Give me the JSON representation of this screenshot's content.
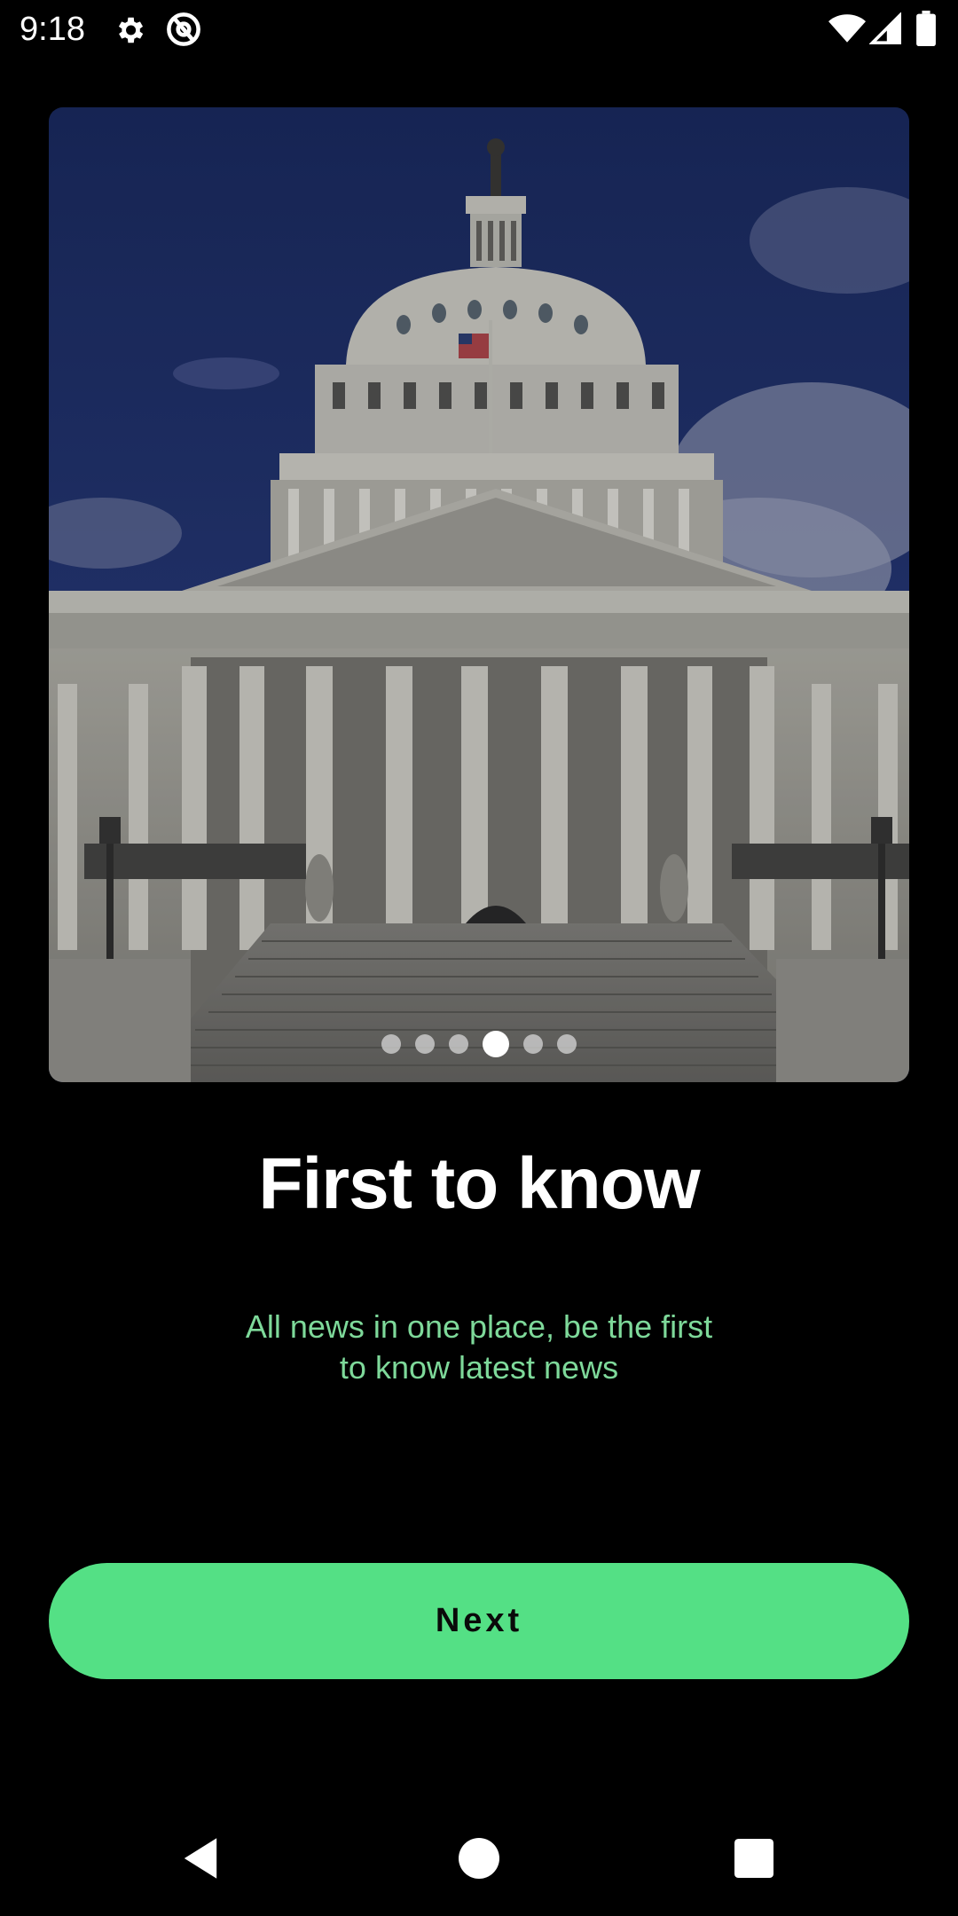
{
  "status_bar": {
    "time": "9:18",
    "icons": [
      "gear-icon",
      "at-sign-icon",
      "wifi-icon",
      "signal-icon",
      "battery-icon"
    ]
  },
  "onboarding": {
    "image_alt": "United States Capitol building",
    "pager": {
      "total": 6,
      "active_index": 3
    },
    "title": "First to know",
    "subtitle": "All news in one place, be the first to know latest news",
    "next_label": "Next"
  },
  "colors": {
    "background": "#000000",
    "accent": "#54e085",
    "subtitle": "#7ed99a",
    "title": "#ffffff"
  },
  "nav_bar": {
    "buttons": [
      "back-icon",
      "home-icon",
      "recents-icon"
    ]
  }
}
